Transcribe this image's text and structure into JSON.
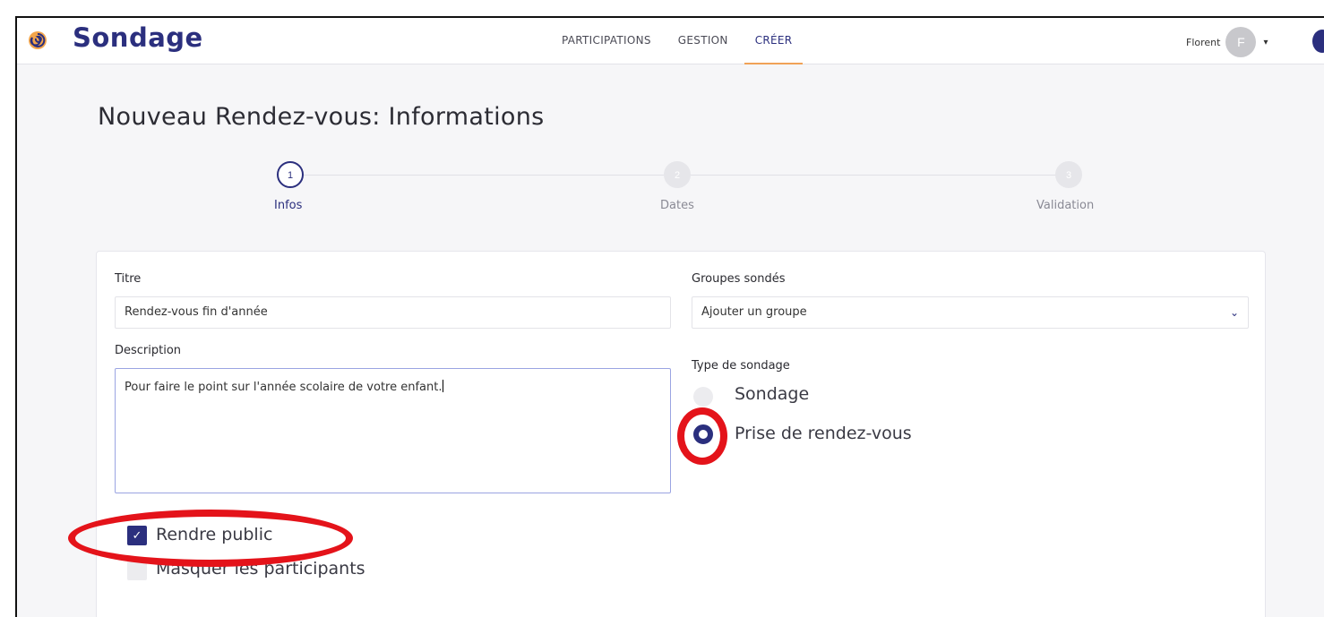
{
  "app": {
    "brand": "Sondage",
    "logo_icon": "spiral-logo-icon"
  },
  "nav": {
    "items": [
      {
        "label": "PARTICIPATIONS"
      },
      {
        "label": "GESTION"
      },
      {
        "label": "CRÉER"
      }
    ],
    "active": "CRÉER"
  },
  "user": {
    "name": "Florent",
    "initial": "F"
  },
  "page": {
    "title": "Nouveau Rendez-vous: Informations"
  },
  "stepper": {
    "steps": [
      {
        "number": "1",
        "label": "Infos",
        "state": "active"
      },
      {
        "number": "2",
        "label": "Dates",
        "state": "inactive"
      },
      {
        "number": "3",
        "label": "Validation",
        "state": "inactive"
      }
    ]
  },
  "form": {
    "titre": {
      "label": "Titre",
      "value": "Rendez-vous fin d'année"
    },
    "description": {
      "label": "Description",
      "value": "Pour faire le point sur l'année scolaire de votre enfant."
    },
    "groupes": {
      "label": "Groupes sondés",
      "placeholder": "Ajouter un groupe"
    },
    "type": {
      "label": "Type de sondage",
      "options": [
        {
          "label": "Sondage",
          "selected": false
        },
        {
          "label": "Prise de rendez-vous",
          "selected": true
        }
      ]
    },
    "checkboxes": [
      {
        "label": "Rendre public",
        "checked": true
      },
      {
        "label": "Masquer les participants",
        "checked": false
      }
    ]
  },
  "colors": {
    "brand": "#2b2f7e",
    "accent": "#f0a257",
    "annotation": "#e4131a"
  }
}
